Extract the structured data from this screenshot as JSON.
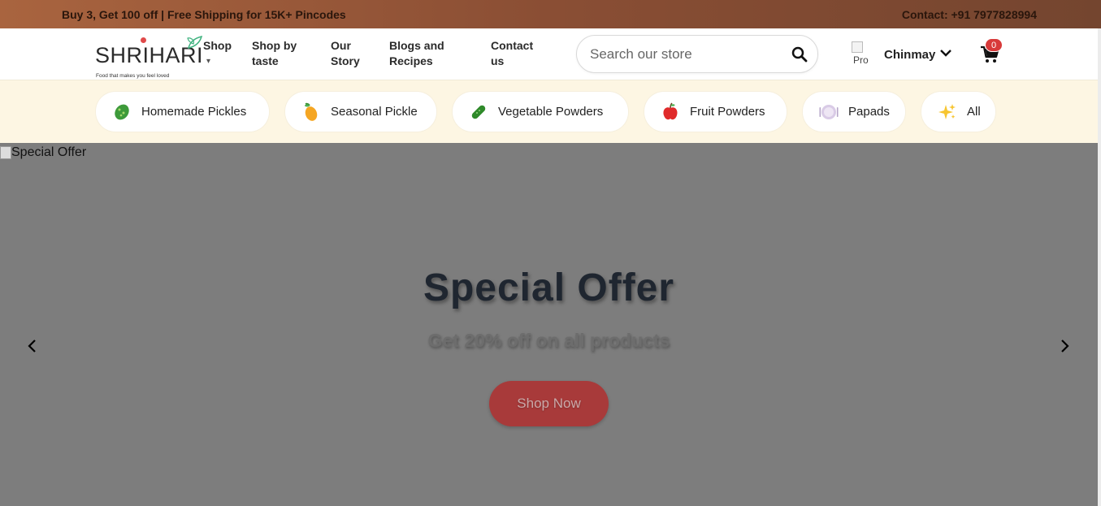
{
  "topbar": {
    "promo": "Buy 3, Get 100 off | Free Shipping for 15K+ Pincodes",
    "contact": "Contact: +91 7977828994"
  },
  "logo": {
    "name": "SHRIHARI",
    "tagline": "Food that makes you feel loved"
  },
  "nav": {
    "shop": "Shop",
    "shop_caret": "▾",
    "shop_by_taste": "Shop by taste",
    "our_story": "Our Story",
    "blogs": "Blogs and Recipes",
    "contact": "Contact us"
  },
  "search": {
    "placeholder": "Search our store"
  },
  "profile": {
    "alt": "Pro",
    "name": "Chinmay"
  },
  "cart": {
    "count": "0"
  },
  "categories": [
    {
      "label": "Homemade Pickles",
      "icon": "green-pickle-icon"
    },
    {
      "label": "Seasonal Pickle",
      "icon": "mango-icon"
    },
    {
      "label": "Vegetable Powders",
      "icon": "cucumber-icon"
    },
    {
      "label": "Fruit Powders",
      "icon": "apple-icon"
    },
    {
      "label": "Papads",
      "icon": "plate-icon"
    },
    {
      "label": "All",
      "icon": "sparkles-icon"
    }
  ],
  "hero": {
    "image_alt": "Special Offer",
    "title": "Special Offer",
    "subtitle": "Get 20% off on all products",
    "button": "Shop Now"
  },
  "colors": {
    "topbar_start": "#a9643f",
    "topbar_end": "#74452f",
    "catbar_bg": "#fdf6e3",
    "hero_overlay": "#7d7d7d",
    "cta": "#a83a3a",
    "badge": "#d83a3a"
  }
}
